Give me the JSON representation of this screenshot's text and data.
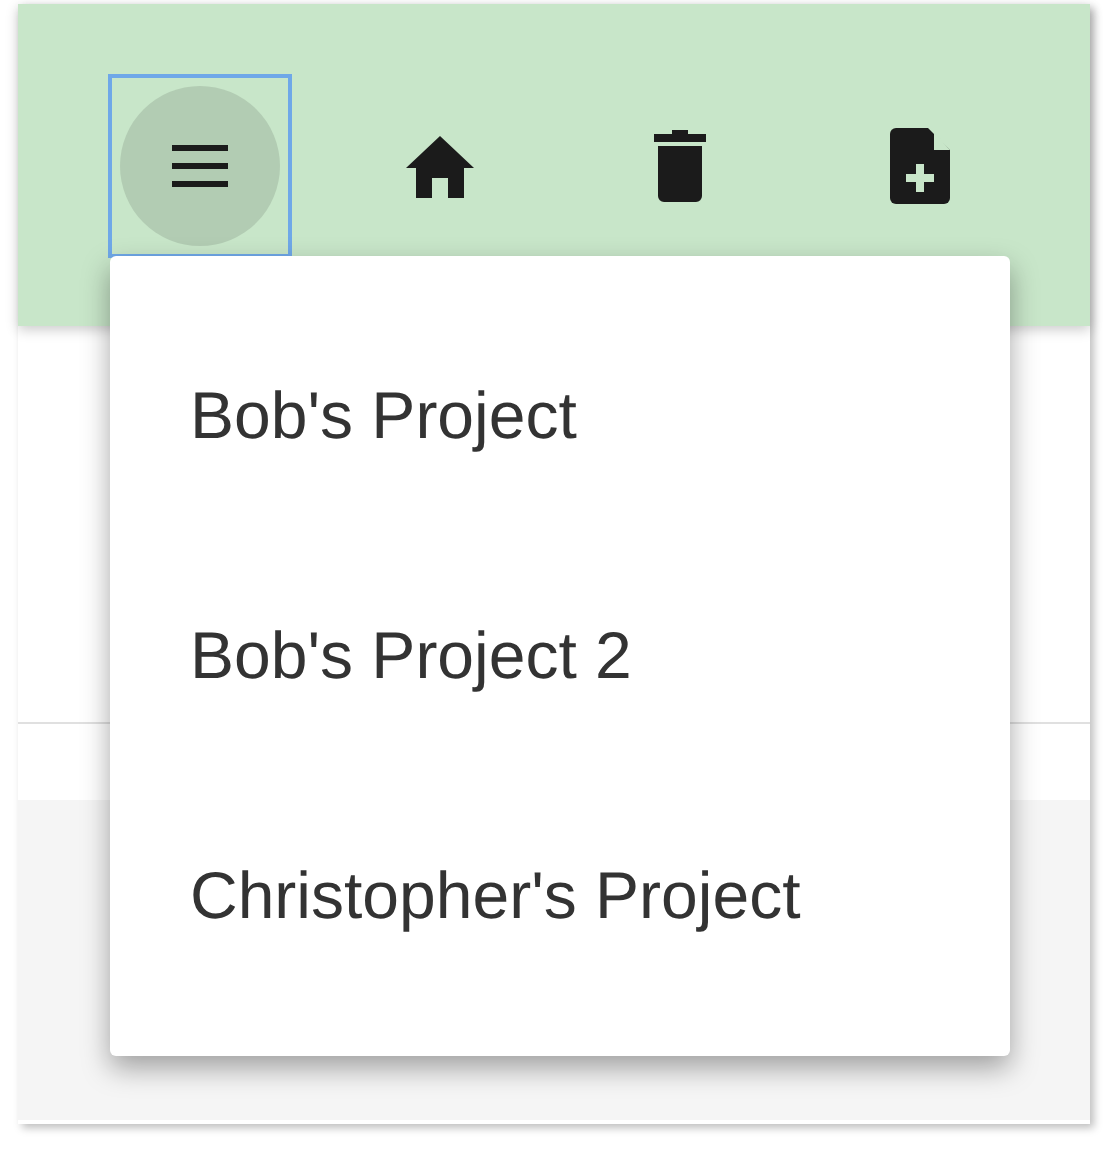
{
  "toolbar": {
    "buttons": [
      {
        "kind": "menu",
        "focused": true
      },
      {
        "kind": "home",
        "focused": false
      },
      {
        "kind": "delete",
        "focused": false
      },
      {
        "kind": "new-file",
        "focused": false
      }
    ]
  },
  "menu": {
    "items": [
      {
        "label": "Bob's Project"
      },
      {
        "label": "Bob's Project 2"
      },
      {
        "label": "Christopher's Project"
      }
    ]
  }
}
